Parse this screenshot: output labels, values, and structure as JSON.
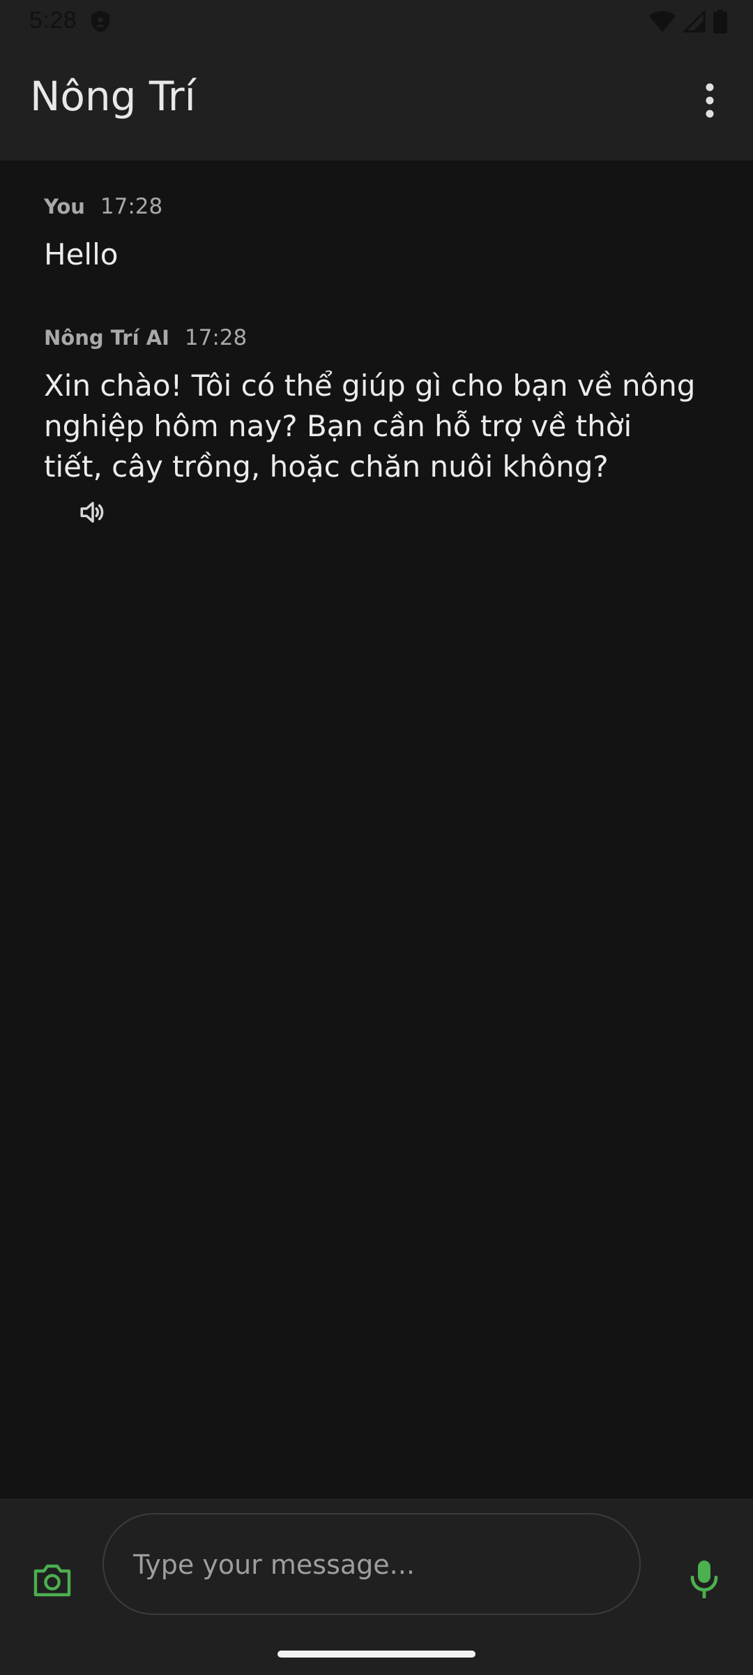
{
  "status_bar": {
    "time": "5:28",
    "icons": [
      "shield-icon",
      "wifi-icon",
      "signal-icon",
      "battery-icon"
    ]
  },
  "app_bar": {
    "title": "Nông Trí",
    "menu_icon": "more-vert-icon"
  },
  "messages": [
    {
      "sender": "You",
      "time": "17:28",
      "text": "Hello"
    },
    {
      "sender": "Nông Trí AI",
      "time": "17:28",
      "text": "Xin chào! Tôi có thể giúp gì cho bạn về nông nghiệp hôm nay? Bạn cần hỗ trợ về thời tiết, cây trồng, hoặc chăn nuôi không?",
      "action_icon": "volume-icon"
    }
  ],
  "input_bar": {
    "camera_icon": "camera-icon",
    "placeholder": "Type your message...",
    "value": "",
    "mic_icon": "mic-icon"
  },
  "colors": {
    "background": "#131313",
    "surface": "#202020",
    "accent": "#4caf50",
    "text_secondary": "#a9a9a9"
  }
}
